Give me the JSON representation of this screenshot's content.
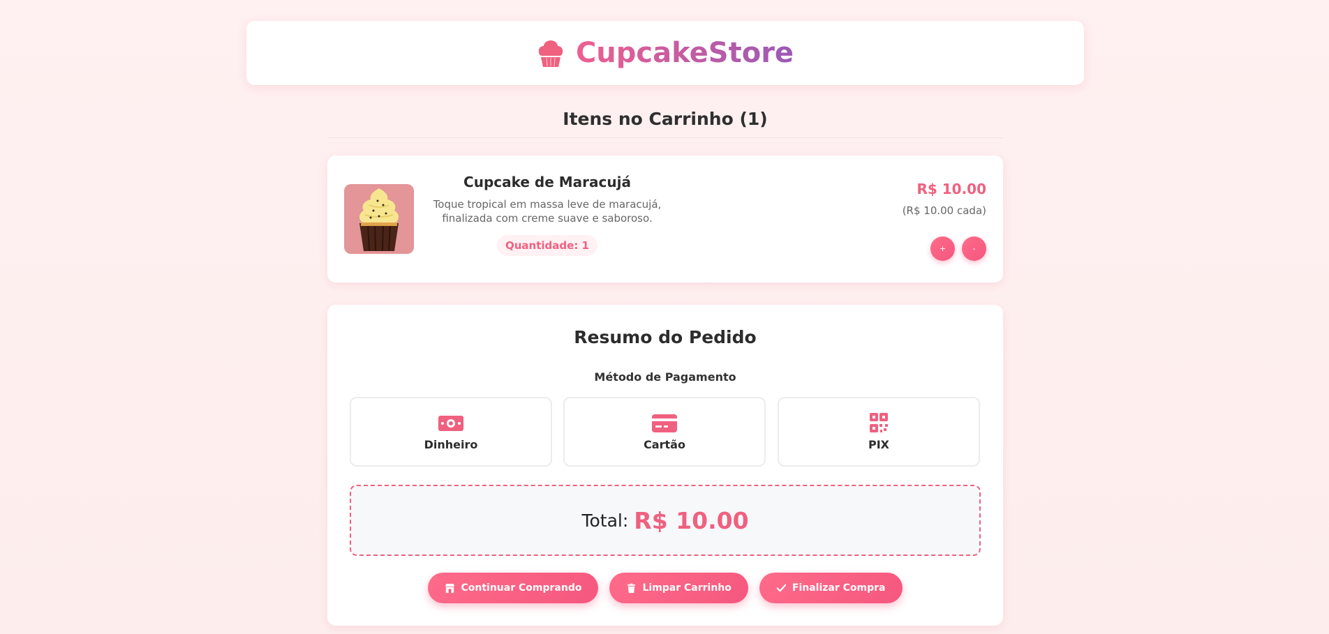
{
  "header": {
    "brand": "CupcakeStore",
    "brand_icon": "cupcake-icon",
    "brand_gradient": [
      "#ef5f8e",
      "#9b59b6"
    ]
  },
  "cart": {
    "title": "Itens no Carrinho (1)"
  },
  "item": {
    "name": "Cupcake de Maracujá",
    "description": "Toque tropical em massa leve de maracujá, finalizada com creme suave e saboroso.",
    "quantity_label": "Quantidade: 1",
    "price": "R$ 10.00",
    "unit_price": "(R$ 10.00 cada)",
    "increase_label": "+",
    "decrease_label": "-"
  },
  "summary": {
    "title": "Resumo do Pedido",
    "payment_label": "Método de Pagamento",
    "payment_options": [
      {
        "label": "Dinheiro",
        "icon": "money-icon"
      },
      {
        "label": "Cartão",
        "icon": "credit-card-icon"
      },
      {
        "label": "PIX",
        "icon": "qr-code-icon"
      }
    ],
    "total_label": "Total:",
    "total_value": "R$ 10.00"
  },
  "actions": {
    "continue": "Continuar Comprando",
    "clear": "Limpar Carrinho",
    "checkout": "Finalizar Compra"
  },
  "colors": {
    "accent": "#f0607f",
    "button": "#f5577e"
  }
}
